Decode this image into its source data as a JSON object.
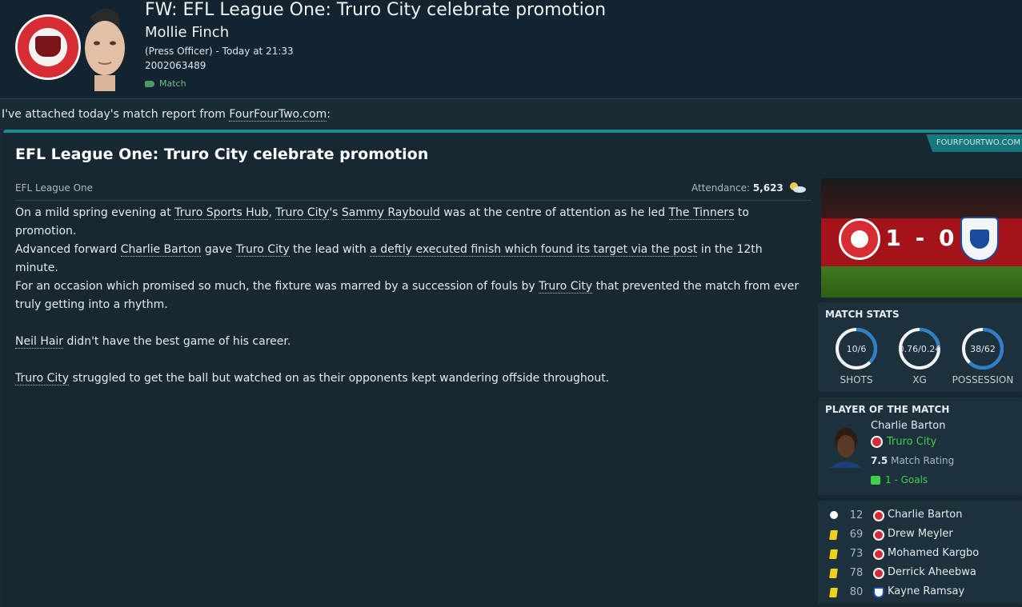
{
  "header": {
    "subject": "FW: EFL League One: Truro City celebrate promotion",
    "sender_name": "Mollie Finch",
    "sender_meta": "(Press Officer) - Today at 21:33",
    "reference": "2002063489",
    "tag": "Match"
  },
  "intro": {
    "prefix": "I've attached today's match report from ",
    "link": "FourFourTwo.com",
    "suffix": ":"
  },
  "article": {
    "source": "FOURFOURTWO.COM",
    "title": "EFL League One: Truro City celebrate promotion",
    "competition": "EFL League One",
    "attendance_label": "Attendance: ",
    "attendance_value": "5,623",
    "p1": {
      "a": "On a mild spring evening at ",
      "venue": "Truro Sports Hub",
      "b": ", ",
      "club": "Truro City",
      "c": "'s ",
      "player": "Sammy Raybould",
      "d": " was at the centre of attention as he led ",
      "nick": "The Tinners",
      "e": " to promotion."
    },
    "p2": {
      "a": "Advanced forward ",
      "player": "Charlie Barton",
      "b": " gave ",
      "club": "Truro City",
      "c": " the lead with ",
      "goal": "a deftly executed finish which found its target via the post",
      "d": " in the 12th minute."
    },
    "p3": {
      "a": "For an occasion which promised so much, the fixture was marred by a succession of fouls by ",
      "club": "Truro City",
      "b": " that prevented the match from ever truly getting into a rhythm."
    },
    "p4": {
      "player": "Neil Hair",
      "a": " didn't have the best game of his career."
    },
    "p5": {
      "club": "Truro City",
      "a": " struggled to get the ball but watched on as their opponents kept wandering offside throughout."
    }
  },
  "score": {
    "text": "1 - 0",
    "home": 1,
    "away": 0
  },
  "match_stats": {
    "heading": "MATCH STATS",
    "stats": [
      {
        "label": "SHOTS",
        "value": "10/6",
        "fraction": 0.625
      },
      {
        "label": "XG",
        "value": "0.76/0.24",
        "fraction": 0.76
      },
      {
        "label": "POSSESSION",
        "value": "38/62",
        "fraction": 0.38
      }
    ]
  },
  "player_of_match": {
    "heading": "PLAYER OF THE MATCH",
    "name": "Charlie Barton",
    "club": "Truro City",
    "rating": "7.5",
    "rating_label": "Match Rating",
    "goals": "1 - Goals"
  },
  "events": [
    {
      "type": "goal",
      "minute": "12",
      "team": "home",
      "player": "Charlie Barton"
    },
    {
      "type": "yellow",
      "minute": "69",
      "team": "home",
      "player": "Drew Meyler"
    },
    {
      "type": "yellow",
      "minute": "73",
      "team": "home",
      "player": "Mohamed Kargbo"
    },
    {
      "type": "yellow",
      "minute": "78",
      "team": "home",
      "player": "Derrick Aheebwa"
    },
    {
      "type": "yellow",
      "minute": "80",
      "team": "away",
      "player": "Kayne Ramsay"
    }
  ],
  "colors": {
    "accent": "#1e8a8e",
    "home": "#d82c34",
    "away": "#1a4c9e",
    "positive": "#3fd04b",
    "ring": "#2d7fd0"
  }
}
